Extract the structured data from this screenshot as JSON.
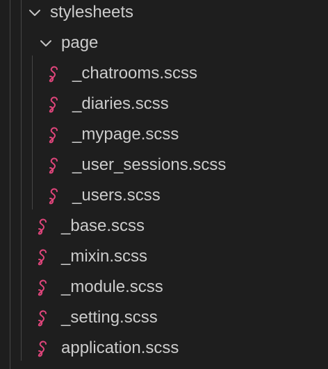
{
  "explorer": {
    "folder_stylesheets": {
      "label": "stylesheets",
      "chevron_icon": "chevron-down-icon",
      "expanded": true
    },
    "folder_page": {
      "label": "page",
      "chevron_icon": "chevron-down-icon",
      "expanded": true
    },
    "page_files": [
      {
        "label": "_chatrooms.scss",
        "icon": "sass-icon"
      },
      {
        "label": "_diaries.scss",
        "icon": "sass-icon"
      },
      {
        "label": "_mypage.scss",
        "icon": "sass-icon"
      },
      {
        "label": "_user_sessions.scss",
        "icon": "sass-icon"
      },
      {
        "label": "_users.scss",
        "icon": "sass-icon"
      }
    ],
    "stylesheet_files": [
      {
        "label": "_base.scss",
        "icon": "sass-icon"
      },
      {
        "label": "_mixin.scss",
        "icon": "sass-icon"
      },
      {
        "label": "_module.scss",
        "icon": "sass-icon"
      },
      {
        "label": "_setting.scss",
        "icon": "sass-icon"
      },
      {
        "label": "application.scss",
        "icon": "sass-icon"
      }
    ],
    "colors": {
      "background": "#1e1e1e",
      "text": "#cccccc",
      "sass_icon": "#e0457b",
      "indent_guide": "#464646"
    }
  }
}
